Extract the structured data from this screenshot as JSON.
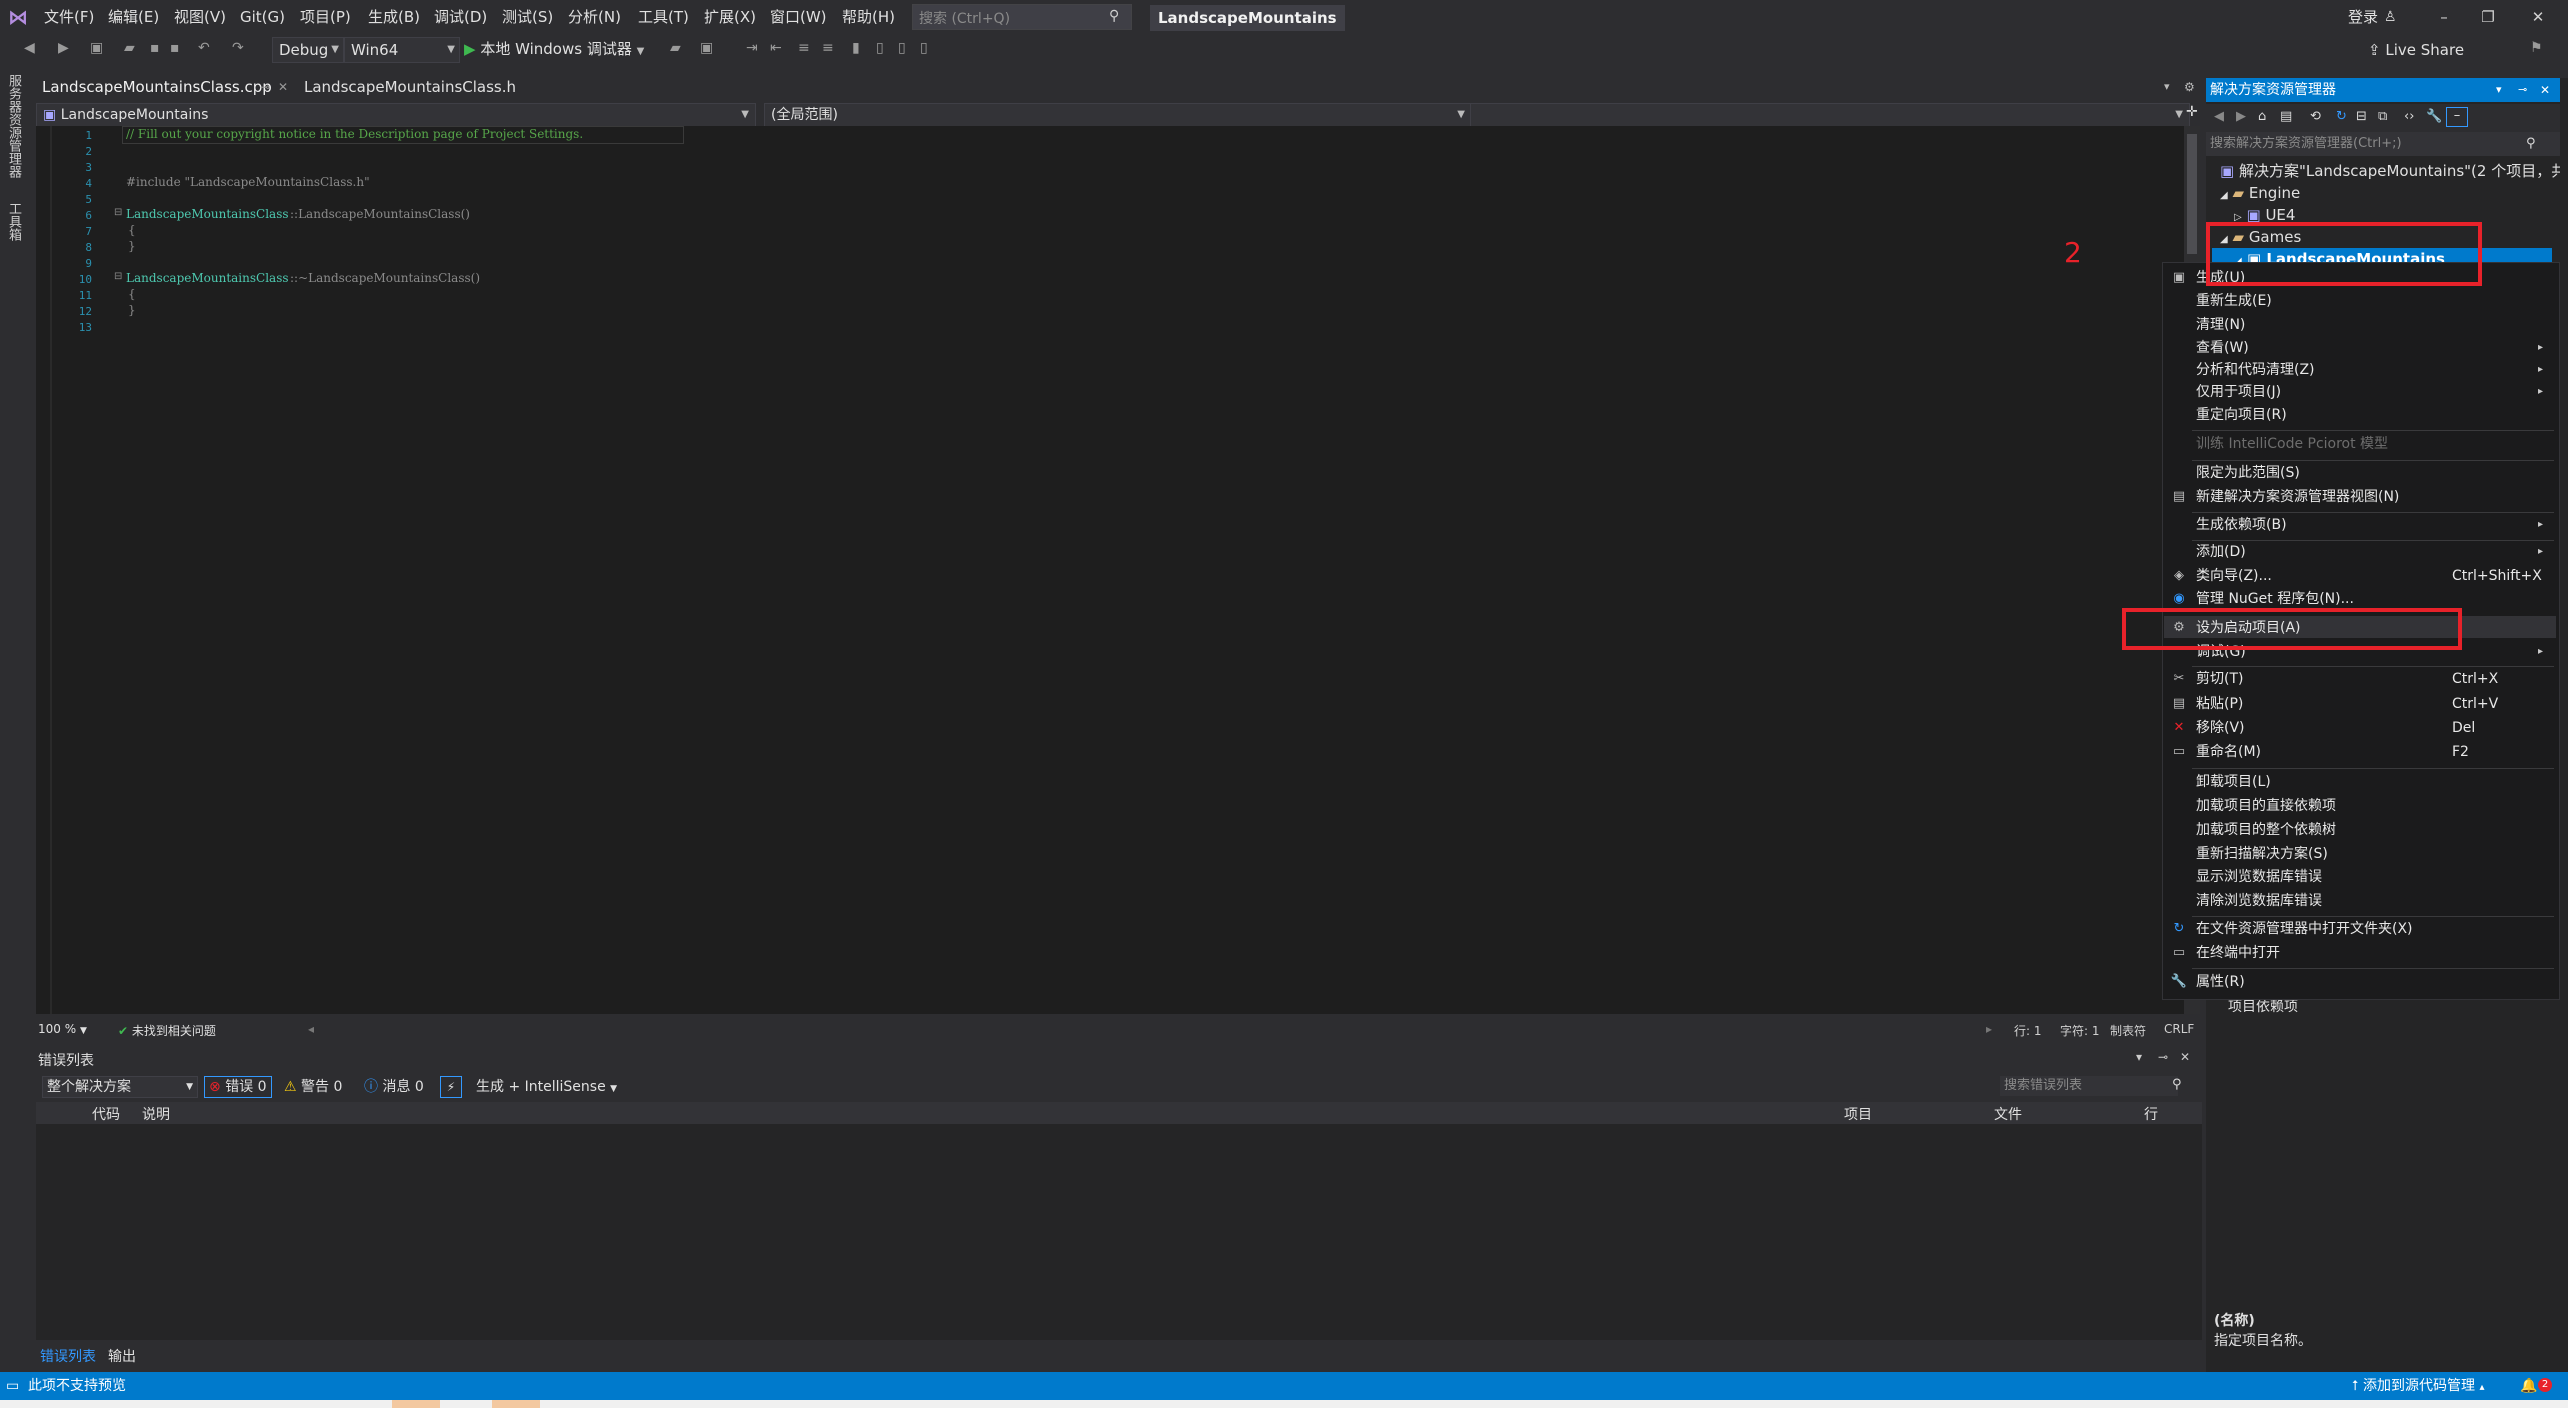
{
  "titlebar": {
    "menus": [
      "文件(F)",
      "编辑(E)",
      "视图(V)",
      "Git(G)",
      "项目(P)",
      "生成(B)",
      "调试(D)",
      "测试(S)",
      "分析(N)",
      "工具(T)",
      "扩展(X)",
      "窗口(W)",
      "帮助(H)"
    ],
    "search_placeholder": "搜索 (Ctrl+Q)",
    "solution_title": "LandscapeMountains",
    "login": "登录",
    "live_share": "Live Share"
  },
  "toolbar": {
    "config": "Debug",
    "platform": "Win64",
    "run_label": "本地 Windows 调试器"
  },
  "left_strip": {
    "server_explorer": "服务器资源管理器",
    "toolbox": "工具箱"
  },
  "doc_tabs": [
    "LandscapeMountainsClass.cpp",
    "LandscapeMountainsClass.h"
  ],
  "navbar": {
    "project": "LandscapeMountains",
    "scope": "(全局范围)"
  },
  "editor": {
    "line_numbers": [
      "1",
      "2",
      "3",
      "4",
      "5",
      "6",
      "7",
      "8",
      "9",
      "10",
      "11",
      "12",
      "13"
    ],
    "lines": {
      "l1": "// Fill out your copyright notice in the Description page of Project Settings.",
      "l4": "#include \"LandscapeMountainsClass.h\"",
      "l6_cls": "LandscapeMountainsClass",
      "l6_rest": "::LandscapeMountainsClass()",
      "l7": "{",
      "l8": "}",
      "l10_cls": "LandscapeMountainsClass",
      "l10_rest": "::~LandscapeMountainsClass()",
      "l11": "{",
      "l12": "}"
    }
  },
  "editor_status": {
    "zoom": "100 %",
    "issues": "未找到相关问题",
    "row": "行: 1",
    "col": "字符: 1",
    "tabs": "制表符",
    "eol": "CRLF"
  },
  "error_list": {
    "title": "错误列表",
    "scope": "整个解决方案",
    "errors": "错误 0",
    "warnings": "警告 0",
    "messages": "消息 0",
    "build_filter": "生成 + IntelliSense",
    "search_placeholder": "搜索错误列表",
    "columns": [
      "代码",
      "说明",
      "项目",
      "文件",
      "行"
    ],
    "tabs": [
      "错误列表",
      "输出"
    ]
  },
  "solution_explorer": {
    "title": "解决方案资源管理器",
    "search_placeholder": "搜索解决方案资源管理器(Ctrl+;)",
    "tree": [
      "解决方案\"LandscapeMountains\"(2 个项目，共 2",
      "Engine",
      "UE4",
      "Games",
      "LandscapeMountains"
    ],
    "project_deps": "项目依赖项",
    "prop_name": "(名称)",
    "prop_desc": "指定项目名称。"
  },
  "annotation_number": "2",
  "context_menu": {
    "items": [
      {
        "label": "生成(U)",
        "shortcut": "",
        "icon": "▣"
      },
      {
        "label": "重新生成(E)",
        "shortcut": "",
        "icon": ""
      },
      {
        "label": "清理(N)",
        "shortcut": "",
        "icon": ""
      },
      {
        "label": "查看(W)",
        "shortcut": "",
        "icon": "",
        "sub": true
      },
      {
        "label": "分析和代码清理(Z)",
        "shortcut": "",
        "icon": "",
        "sub": true
      },
      {
        "label": "仅用于项目(J)",
        "shortcut": "",
        "icon": "",
        "sub": true
      },
      {
        "label": "重定向项目(R)",
        "shortcut": "",
        "icon": ""
      },
      {
        "label": "训练 IntelliCode Pciorot 模型",
        "shortcut": "",
        "icon": "",
        "disabled": true
      },
      {
        "label": "限定为此范围(S)",
        "shortcut": "",
        "icon": ""
      },
      {
        "label": "新建解决方案资源管理器视图(N)",
        "shortcut": "",
        "icon": "▤"
      },
      {
        "label": "生成依赖项(B)",
        "shortcut": "",
        "icon": "",
        "sub": true
      },
      {
        "label": "添加(D)",
        "shortcut": "",
        "icon": "",
        "sub": true
      },
      {
        "label": "类向导(Z)...",
        "shortcut": "Ctrl+Shift+X",
        "icon": "◈"
      },
      {
        "label": "管理 NuGet 程序包(N)...",
        "shortcut": "",
        "icon": "◉"
      },
      {
        "label": "设为启动项目(A)",
        "shortcut": "",
        "icon": "⚙"
      },
      {
        "label": "调试(G)",
        "shortcut": "",
        "icon": "",
        "sub": true
      },
      {
        "label": "剪切(T)",
        "shortcut": "Ctrl+X",
        "icon": "✂"
      },
      {
        "label": "粘贴(P)",
        "shortcut": "Ctrl+V",
        "icon": "▤"
      },
      {
        "label": "移除(V)",
        "shortcut": "Del",
        "icon": "✕"
      },
      {
        "label": "重命名(M)",
        "shortcut": "F2",
        "icon": "▭"
      },
      {
        "label": "卸载项目(L)",
        "shortcut": "",
        "icon": ""
      },
      {
        "label": "加载项目的直接依赖项",
        "shortcut": "",
        "icon": ""
      },
      {
        "label": "加载项目的整个依赖树",
        "shortcut": "",
        "icon": ""
      },
      {
        "label": "重新扫描解决方案(S)",
        "shortcut": "",
        "icon": ""
      },
      {
        "label": "显示浏览数据库错误",
        "shortcut": "",
        "icon": ""
      },
      {
        "label": "清除浏览数据库错误",
        "shortcut": "",
        "icon": ""
      },
      {
        "label": "在文件资源管理器中打开文件夹(X)",
        "shortcut": "",
        "icon": "↻"
      },
      {
        "label": "在终端中打开",
        "shortcut": "",
        "icon": "▭"
      },
      {
        "label": "属性(R)",
        "shortcut": "",
        "icon": "🔧"
      }
    ]
  },
  "statusbar": {
    "left": "此项不支持预览",
    "right": "添加到源代码管理",
    "notif_count": "2"
  },
  "colors": {
    "accent": "#007acc",
    "highlight_box": "#e8222a",
    "editor_bg": "#1e1e1e",
    "chrome_bg": "#2d2d30"
  }
}
